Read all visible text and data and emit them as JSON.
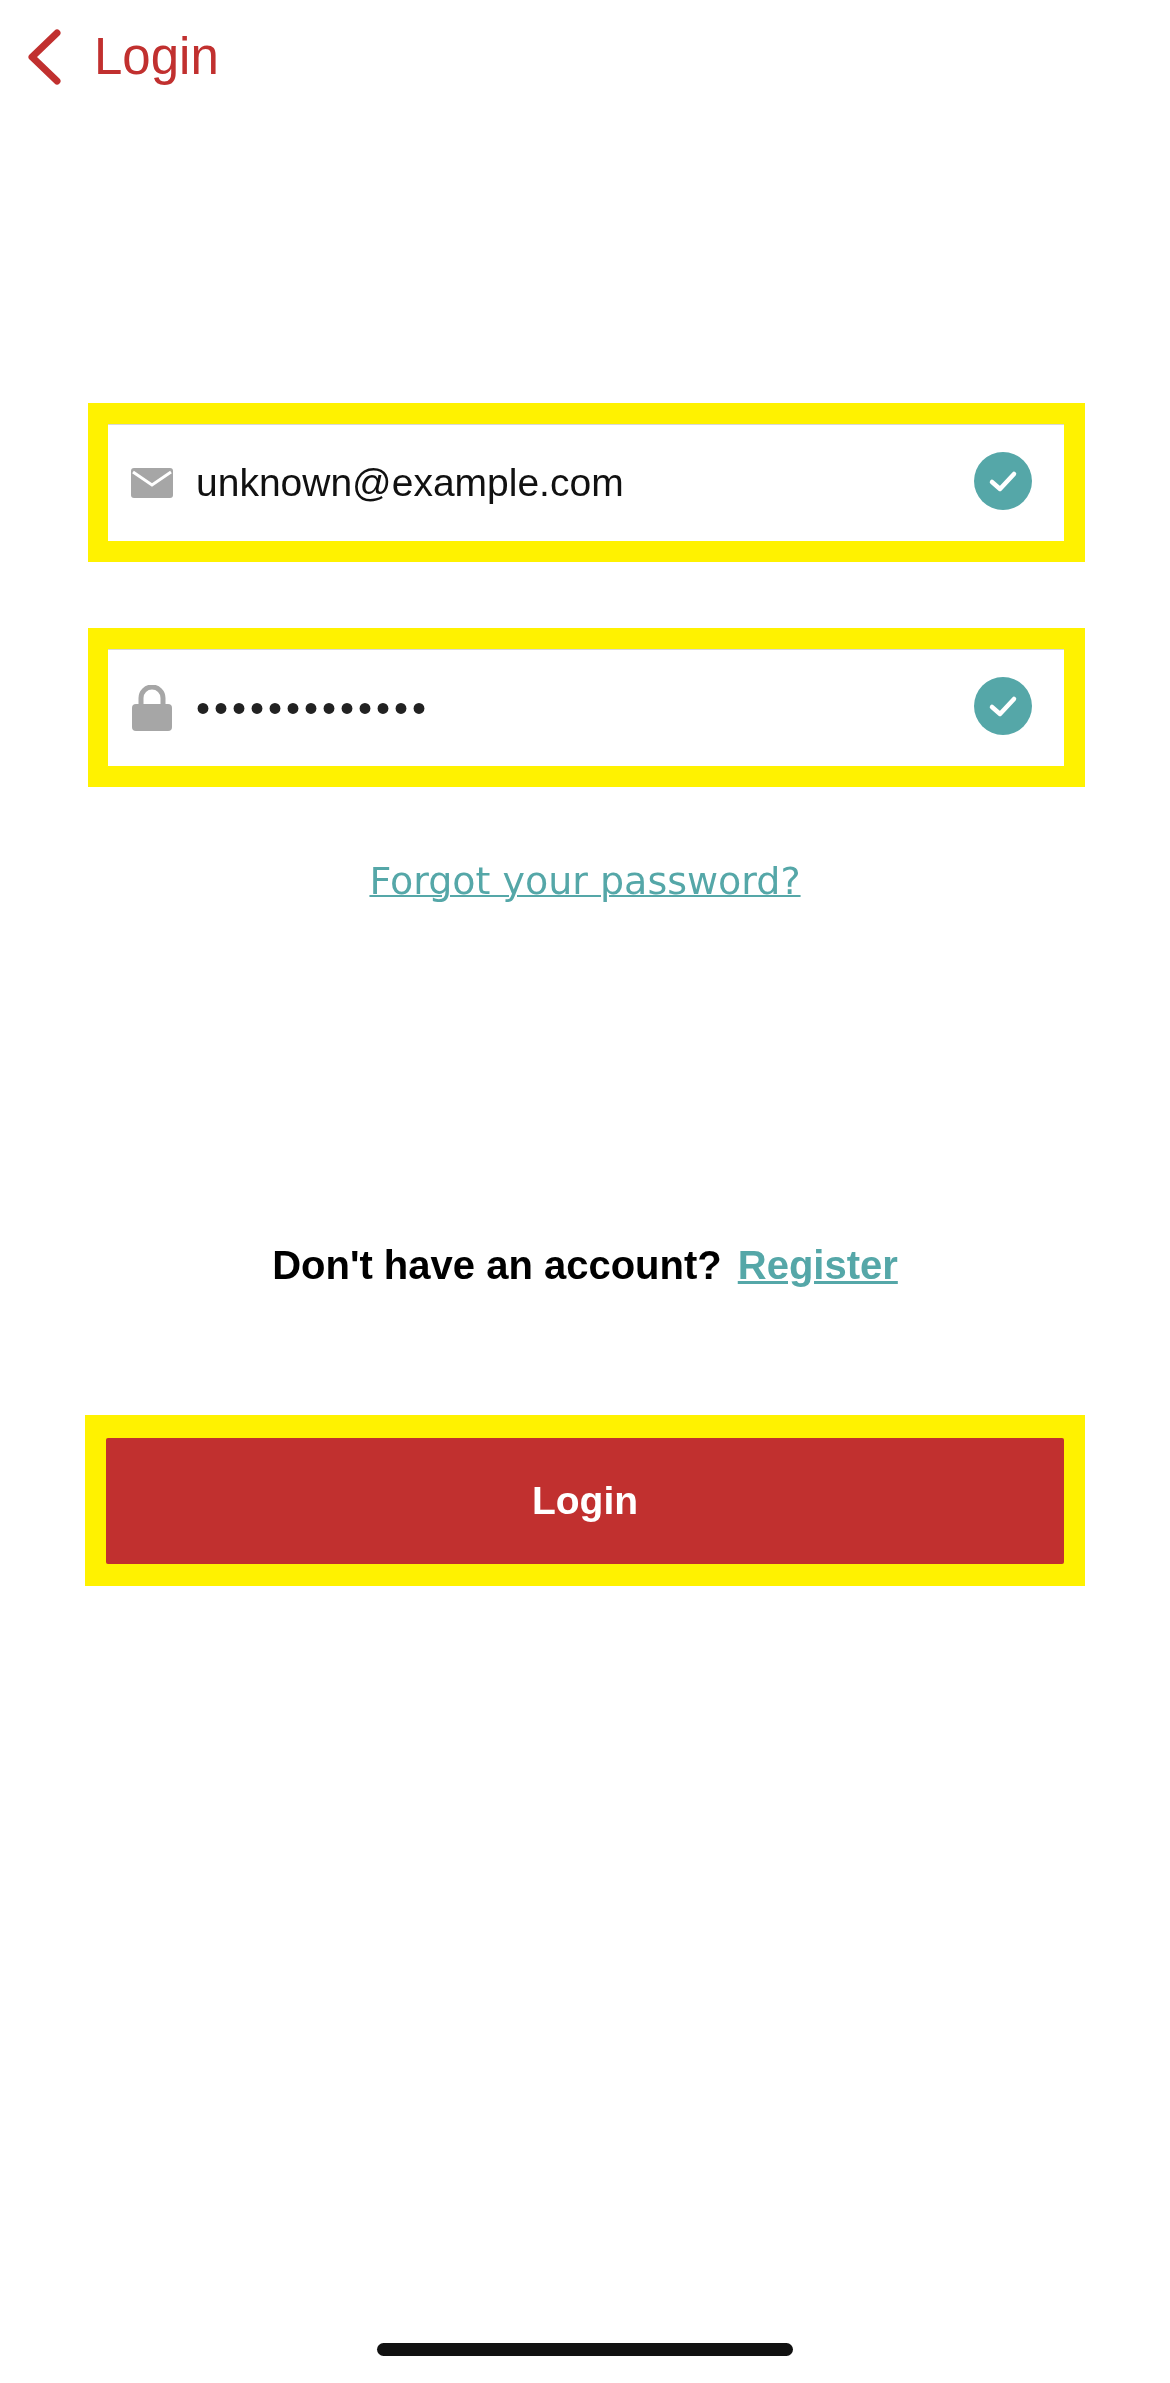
{
  "header": {
    "title": "Login"
  },
  "fields": [
    {
      "kind": "email",
      "value": "unknown@example.com",
      "valid": true,
      "highlighted": true
    },
    {
      "kind": "password",
      "value": "•••••••••••••",
      "valid": true,
      "highlighted": true
    }
  ],
  "forgot_link": "Forgot your password?",
  "register_prompt": {
    "text": "Don't have an account?",
    "link": "Register"
  },
  "login_button": {
    "label": "Login",
    "highlighted": true
  }
}
